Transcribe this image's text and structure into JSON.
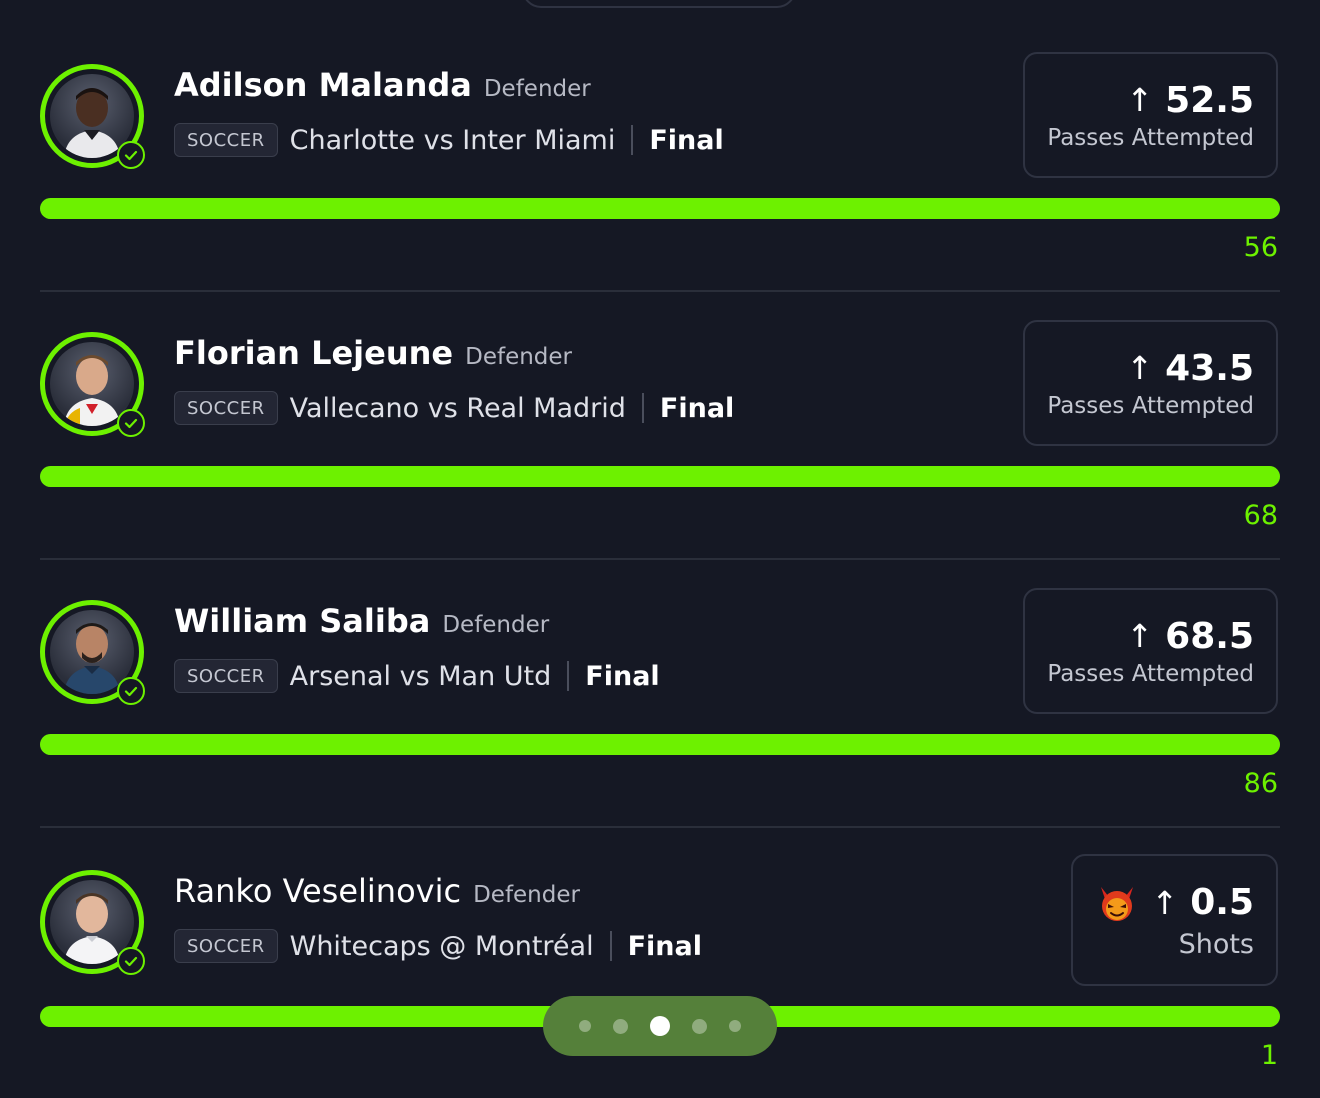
{
  "picks": [
    {
      "name": "Adilson Malanda",
      "position": "Defender",
      "sport": "SOCCER",
      "matchup": "Charlotte vs Inter Miami",
      "status": "Final",
      "direction_icon": "arrow-up-icon",
      "line": "52.5",
      "stat": "Passes Attempted",
      "actual": "56",
      "progress": 1.0
    },
    {
      "name": "Florian Lejeune",
      "position": "Defender",
      "sport": "SOCCER",
      "matchup": "Vallecano vs Real Madrid",
      "status": "Final",
      "direction_icon": "arrow-up-icon",
      "line": "43.5",
      "stat": "Passes Attempted",
      "actual": "68",
      "progress": 1.0
    },
    {
      "name": "William Saliba",
      "position": "Defender",
      "sport": "SOCCER",
      "matchup": "Arsenal vs Man Utd",
      "status": "Final",
      "direction_icon": "arrow-up-icon",
      "line": "68.5",
      "stat": "Passes Attempted",
      "actual": "86",
      "progress": 1.0
    },
    {
      "name": "Ranko Veselinovic",
      "position": "Defender",
      "sport": "SOCCER",
      "matchup": "Whitecaps @ Montréal",
      "status": "Final",
      "direction_icon": "arrow-up-icon",
      "badge_icon": "demon-icon",
      "line": "0.5",
      "stat": "Shots",
      "actual": "1",
      "progress": 1.0
    }
  ],
  "pager": {
    "count": 5,
    "active_index": 2
  },
  "colors": {
    "background": "#151824",
    "accent": "#6df100",
    "card_border": "#2f3342",
    "pager_bg": "#55803a"
  }
}
